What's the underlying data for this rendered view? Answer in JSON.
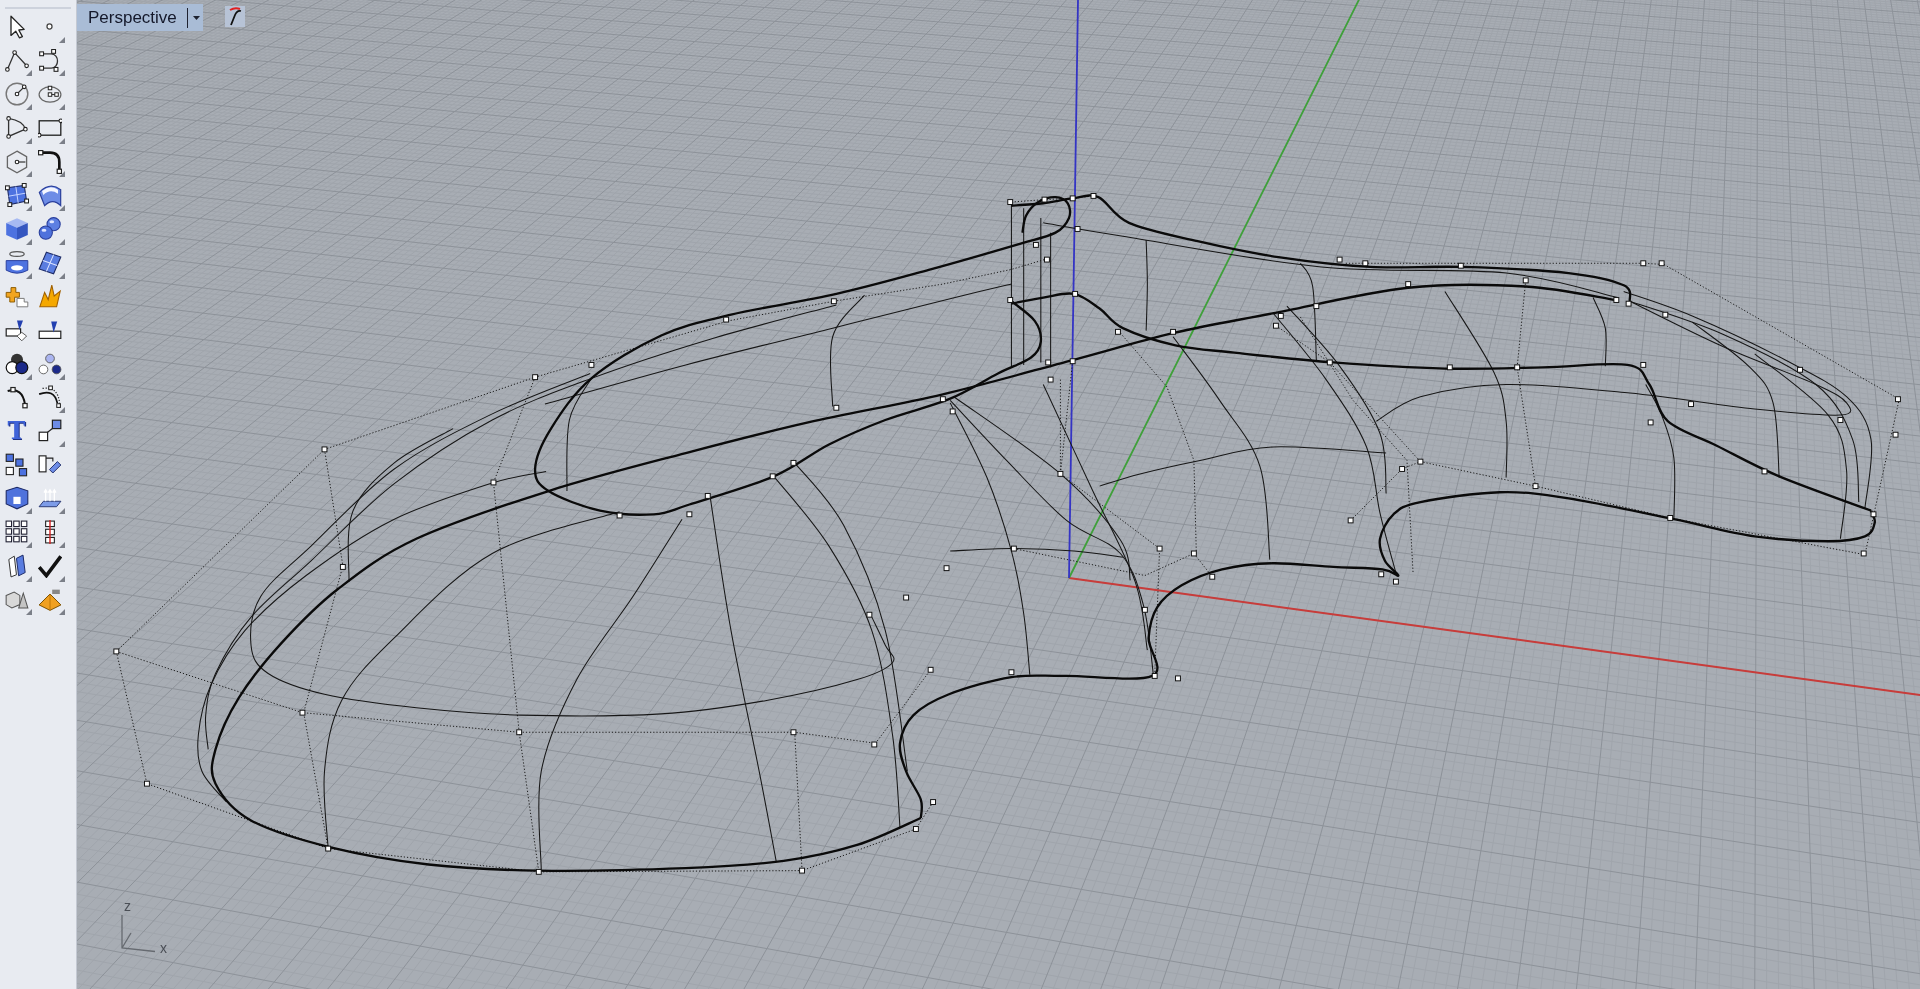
{
  "viewport": {
    "title": "Perspective",
    "active": true,
    "axis_triad": {
      "z_label": "z",
      "x_label": "x"
    }
  },
  "toolbar": {
    "tools": [
      {
        "flyout": false
      },
      {
        "flyout": true
      },
      {
        "flyout": true
      },
      {
        "flyout": true
      },
      {
        "flyout": true
      },
      {
        "flyout": true
      },
      {
        "flyout": true
      },
      {
        "flyout": true
      },
      {
        "flyout": true
      },
      {
        "flyout": true
      },
      {
        "flyout": true
      },
      {
        "flyout": true
      },
      {
        "flyout": true
      },
      {
        "flyout": true
      },
      {
        "flyout": true
      },
      {
        "flyout": true
      },
      {
        "flyout": false
      },
      {
        "flyout": false
      },
      {
        "flyout": false
      },
      {
        "flyout": false
      },
      {
        "flyout": true
      },
      {
        "flyout": true
      },
      {
        "flyout": false
      },
      {
        "flyout": true
      },
      {
        "flyout": false,
        "glyph": "T"
      },
      {
        "flyout": true
      },
      {
        "flyout": false
      },
      {
        "flyout": false
      },
      {
        "flyout": true
      },
      {
        "flyout": true
      },
      {
        "flyout": true
      },
      {
        "flyout": true
      },
      {
        "flyout": true
      },
      {
        "flyout": true
      },
      {
        "flyout": true
      },
      {
        "flyout": true
      }
    ]
  }
}
